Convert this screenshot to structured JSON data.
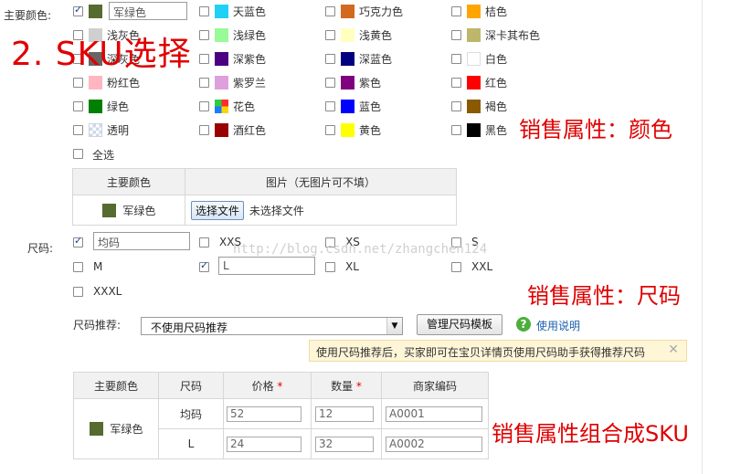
{
  "color_section": {
    "label": "主要颜色:",
    "selected_input": "军绿色",
    "colors": [
      {
        "name": "军绿色",
        "hex": "#556b2f",
        "checked": true
      },
      {
        "name": "天蓝色",
        "hex": "#1fd1f5",
        "checked": false
      },
      {
        "name": "巧克力色",
        "hex": "#d2691e",
        "checked": false
      },
      {
        "name": "桔色",
        "hex": "#ffa500",
        "checked": false
      },
      {
        "name": "浅灰色",
        "hex": "#cfcfcf",
        "checked": false
      },
      {
        "name": "浅绿色",
        "hex": "#98fb98",
        "checked": false
      },
      {
        "name": "浅黄色",
        "hex": "#ffffc0",
        "checked": false
      },
      {
        "name": "深卡其布色",
        "hex": "#bdb76b",
        "checked": false
      },
      {
        "name": "深灰色",
        "hex": "#666666",
        "checked": false
      },
      {
        "name": "深紫色",
        "hex": "#4b0082",
        "checked": false
      },
      {
        "name": "深蓝色",
        "hex": "#000080",
        "checked": false
      },
      {
        "name": "白色",
        "hex": "#ffffff",
        "checked": false
      },
      {
        "name": "粉红色",
        "hex": "#ffb6c1",
        "checked": false
      },
      {
        "name": "紫罗兰",
        "hex": "#dda0dd",
        "checked": false
      },
      {
        "name": "紫色",
        "hex": "#800080",
        "checked": false
      },
      {
        "name": "红色",
        "hex": "#ff0000",
        "checked": false
      },
      {
        "name": "绿色",
        "hex": "#008000",
        "checked": false
      },
      {
        "name": "花色",
        "hex": "pattern-floral",
        "checked": false
      },
      {
        "name": "蓝色",
        "hex": "#0000ff",
        "checked": false
      },
      {
        "name": "褐色",
        "hex": "#8b5a00",
        "checked": false
      },
      {
        "name": "透明",
        "hex": "pattern-transparent",
        "checked": false
      },
      {
        "name": "酒红色",
        "hex": "#990000",
        "checked": false
      },
      {
        "name": "黄色",
        "hex": "#ffff00",
        "checked": false
      },
      {
        "name": "黑色",
        "hex": "#000000",
        "checked": false
      }
    ],
    "select_all": "全选",
    "image_table": {
      "headers": [
        "主要颜色",
        "图片（无图片可不填）"
      ],
      "row_color": "军绿色",
      "file_button": "选择文件",
      "file_status": "未选择文件"
    }
  },
  "size_section": {
    "label": "尺码:",
    "sizes": [
      {
        "name": "均码",
        "checked": true,
        "input": true
      },
      {
        "name": "XXS",
        "checked": false,
        "input": false
      },
      {
        "name": "XS",
        "checked": false,
        "input": false
      },
      {
        "name": "S",
        "checked": false,
        "input": false
      },
      {
        "name": "M",
        "checked": false,
        "input": false
      },
      {
        "name": "L",
        "checked": true,
        "input": true
      },
      {
        "name": "XL",
        "checked": false,
        "input": false
      },
      {
        "name": "XXL",
        "checked": false,
        "input": false
      },
      {
        "name": "XXXL",
        "checked": false,
        "input": false
      }
    ],
    "recommend_label": "尺码推荐:",
    "recommend_value": "不使用尺码推荐",
    "manage_button": "管理尺码模板",
    "help_link": "使用说明",
    "tip_text": "使用尺码推荐后，买家即可在宝贝详情页使用尺码助手获得推荐尺码"
  },
  "sku_table": {
    "headers": [
      "主要颜色",
      "尺码",
      "价格",
      "数量",
      "商家编码"
    ],
    "required_mark": "*",
    "color": "军绿色",
    "rows": [
      {
        "size": "均码",
        "price": "52",
        "qty": "12",
        "code": "A0001"
      },
      {
        "size": "L",
        "price": "24",
        "qty": "32",
        "code": "A0002"
      }
    ]
  },
  "annotations": {
    "title": "2. SKU选择",
    "color": "销售属性：颜色",
    "size": "销售属性：尺码",
    "combo": "销售属性组合成SKU"
  },
  "watermark": "http://blog.csdn.net/zhangchen124"
}
